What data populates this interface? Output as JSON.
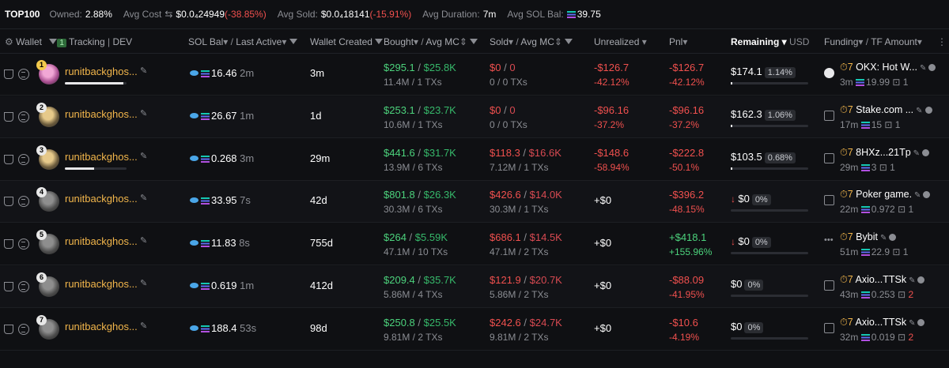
{
  "stats": {
    "title": "TOP100",
    "owned_label": "Owned:",
    "owned": "2.88%",
    "avg_cost_label": "Avg Cost",
    "avg_cost": "$0.0₄24949",
    "avg_cost_change": "(-38.85%)",
    "avg_sold_label": "Avg Sold:",
    "avg_sold": "$0.0₄18141",
    "avg_sold_change": "(-15.91%)",
    "avg_duration_label": "Avg Duration:",
    "avg_duration": "7m",
    "avg_sol_bal_label": "Avg SOL Bal:",
    "avg_sol_bal": "39.75"
  },
  "header": {
    "wallet": "Wallet",
    "tracking_count": "1",
    "tracking": "Tracking",
    "dev": "DEV",
    "sol_bal": "SOL Bal",
    "last_active": "Last Active",
    "wallet_created": "Wallet Created",
    "bought": "Bought",
    "bought_mc": "Avg MC",
    "sold": "Sold",
    "sold_mc": "Avg MC",
    "unrealized": "Unrealized",
    "pnl": "Pnl",
    "remaining": "Remaining",
    "usd": "USD",
    "funding": "Funding",
    "tf_amount": "TF Amount"
  },
  "rows": [
    {
      "rank": "1",
      "name": "runitbackghos...",
      "bar": 0.95,
      "sol_bal": "16.46",
      "last_active": "2m",
      "created": "3m",
      "bought": "$295.1",
      "bought_mc": "$25.8K",
      "bought_sub": "11.4M / 1 TXs",
      "sold": "$0",
      "sold_mc": "0",
      "sold_sub": "0 / 0 TXs",
      "unreal": "-$126.7",
      "unreal_pct": "-42.12%",
      "pnl": "-$126.7",
      "pnl_pct": "-42.12%",
      "remain": "$174.1",
      "remain_pct": "1.14%",
      "fund_name": "OKX: Hot W...",
      "fund_time": "3m",
      "fund_amt": "19.99",
      "fund_tx": "1"
    },
    {
      "rank": "2",
      "name": "runitbackghos...",
      "bar": 0,
      "sol_bal": "26.67",
      "last_active": "1m",
      "created": "1d",
      "bought": "$253.1",
      "bought_mc": "$23.7K",
      "bought_sub": "10.6M / 1 TXs",
      "sold": "$0",
      "sold_mc": "0",
      "sold_sub": "0 / 0 TXs",
      "unreal": "-$96.16",
      "unreal_pct": "-37.2%",
      "pnl": "-$96.16",
      "pnl_pct": "-37.2%",
      "remain": "$162.3",
      "remain_pct": "1.06%",
      "fund_name": "Stake.com ...",
      "fund_time": "17m",
      "fund_amt": "15",
      "fund_tx": "1"
    },
    {
      "rank": "3",
      "name": "runitbackghos...",
      "bar": 0.48,
      "sol_bal": "0.268",
      "last_active": "3m",
      "created": "29m",
      "bought": "$441.6",
      "bought_mc": "$31.7K",
      "bought_sub": "13.9M / 6 TXs",
      "sold": "$118.3",
      "sold_mc": "$16.6K",
      "sold_sub": "7.12M / 1 TXs",
      "unreal": "-$148.6",
      "unreal_pct": "-58.94%",
      "pnl": "-$222.8",
      "pnl_pct": "-50.1%",
      "remain": "$103.5",
      "remain_pct": "0.68%",
      "fund_name": "8HXz...21Tp",
      "fund_time": "29m",
      "fund_amt": "3",
      "fund_tx": "1"
    },
    {
      "rank": "4",
      "name": "runitbackghos...",
      "bar": 0,
      "sol_bal": "33.95",
      "last_active": "7s",
      "created": "42d",
      "bought": "$801.8",
      "bought_mc": "$26.3K",
      "bought_sub": "30.3M / 6 TXs",
      "sold": "$426.6",
      "sold_mc": "$14.0K",
      "sold_sub": "30.3M / 1 TXs",
      "unreal": "+$0",
      "unreal_pct": "",
      "pnl": "-$396.2",
      "pnl_pct": "-48.15%",
      "remain": "$0",
      "remain_pct": "0%",
      "fund_name": "Poker game.",
      "fund_time": "22m",
      "fund_amt": "0.972",
      "fund_tx": "1"
    },
    {
      "rank": "5",
      "name": "runitbackghos...",
      "bar": 0,
      "sol_bal": "11.83",
      "last_active": "8s",
      "created": "755d",
      "bought": "$264",
      "bought_mc": "$5.59K",
      "bought_sub": "47.1M / 10 TXs",
      "sold": "$686.1",
      "sold_mc": "$14.5K",
      "sold_sub": "47.1M / 2 TXs",
      "unreal": "+$0",
      "unreal_pct": "",
      "pnl": "+$418.1",
      "pnl_pct": "+155.96%",
      "remain": "$0",
      "remain_pct": "0%",
      "fund_name": "Bybit",
      "fund_time": "51m",
      "fund_amt": "22.9",
      "fund_tx": "1"
    },
    {
      "rank": "6",
      "name": "runitbackghos...",
      "bar": 0,
      "sol_bal": "0.619",
      "last_active": "1m",
      "created": "412d",
      "bought": "$209.4",
      "bought_mc": "$35.7K",
      "bought_sub": "5.86M / 4 TXs",
      "sold": "$121.9",
      "sold_mc": "$20.7K",
      "sold_sub": "5.86M / 2 TXs",
      "unreal": "+$0",
      "unreal_pct": "",
      "pnl": "-$88.09",
      "pnl_pct": "-41.95%",
      "remain": "$0",
      "remain_pct": "0%",
      "fund_name": "Axio...TTSk",
      "fund_time": "43m",
      "fund_amt": "0.253",
      "fund_tx": "2"
    },
    {
      "rank": "7",
      "name": "runitbackghos...",
      "bar": 0,
      "sol_bal": "188.4",
      "last_active": "53s",
      "created": "98d",
      "bought": "$250.8",
      "bought_mc": "$25.5K",
      "bought_sub": "9.81M / 2 TXs",
      "sold": "$242.6",
      "sold_mc": "$24.7K",
      "sold_sub": "9.81M / 2 TXs",
      "unreal": "+$0",
      "unreal_pct": "",
      "pnl": "-$10.6",
      "pnl_pct": "-4.19%",
      "remain": "$0",
      "remain_pct": "0%",
      "fund_name": "Axio...TTSk",
      "fund_time": "32m",
      "fund_amt": "0.019",
      "fund_tx": "2"
    }
  ],
  "fund_prefix": "7"
}
